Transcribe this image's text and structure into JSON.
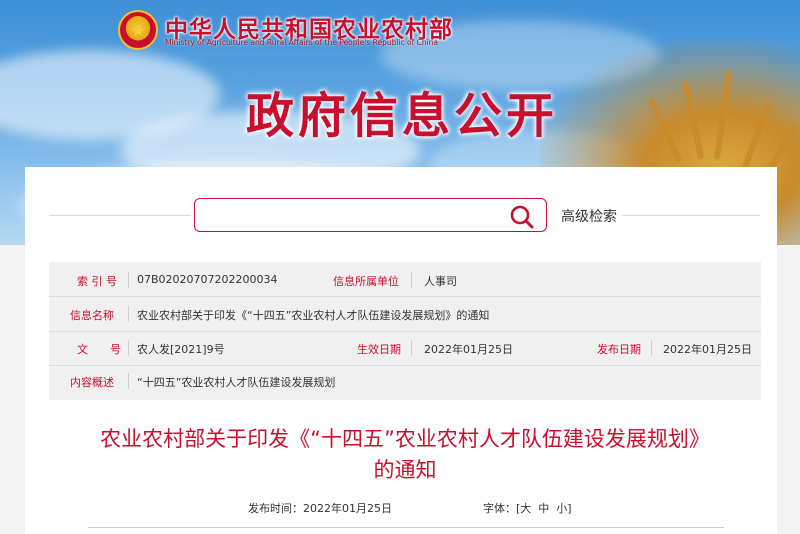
{
  "header": {
    "ministry_cn": "中华人民共和国农业农村部",
    "ministry_en": "Ministry of Agriculture and Rural Affairs of the People's Republic of China",
    "section_title": "政府信息公开"
  },
  "search": {
    "placeholder": "",
    "advanced_label": "高级检索"
  },
  "meta": {
    "index_label": "索 引 号",
    "index_value": "07B02020707202200034",
    "org_label": "信息所属单位",
    "org_value": "人事司",
    "name_label": "信息名称",
    "name_value": "农业农村部关于印发《“十四五”农业农村人才队伍建设发展规划》的通知",
    "doc_label": "文　　号",
    "doc_value": "农人发[2021]9号",
    "effective_label": "生效日期",
    "effective_value": "2022年01月25日",
    "publish_label": "发布日期",
    "publish_value": "2022年01月25日",
    "summary_label": "内容概述",
    "summary_value": "“十四五”农业农村人才队伍建设发展规划"
  },
  "article": {
    "title_line1": "农业农村部关于印发《“十四五”农业农村人才队伍建设发展规划》",
    "title_line2": "的通知",
    "publish_time": "发布时间：2022年01月25日",
    "font_size_label": "字体：",
    "font_size_open": "[",
    "font_large": "大",
    "font_medium": "中",
    "font_small": "小",
    "font_size_close": "]"
  },
  "colors": {
    "accent": "#c8102e",
    "meta_bg": "#f0f0f0"
  }
}
